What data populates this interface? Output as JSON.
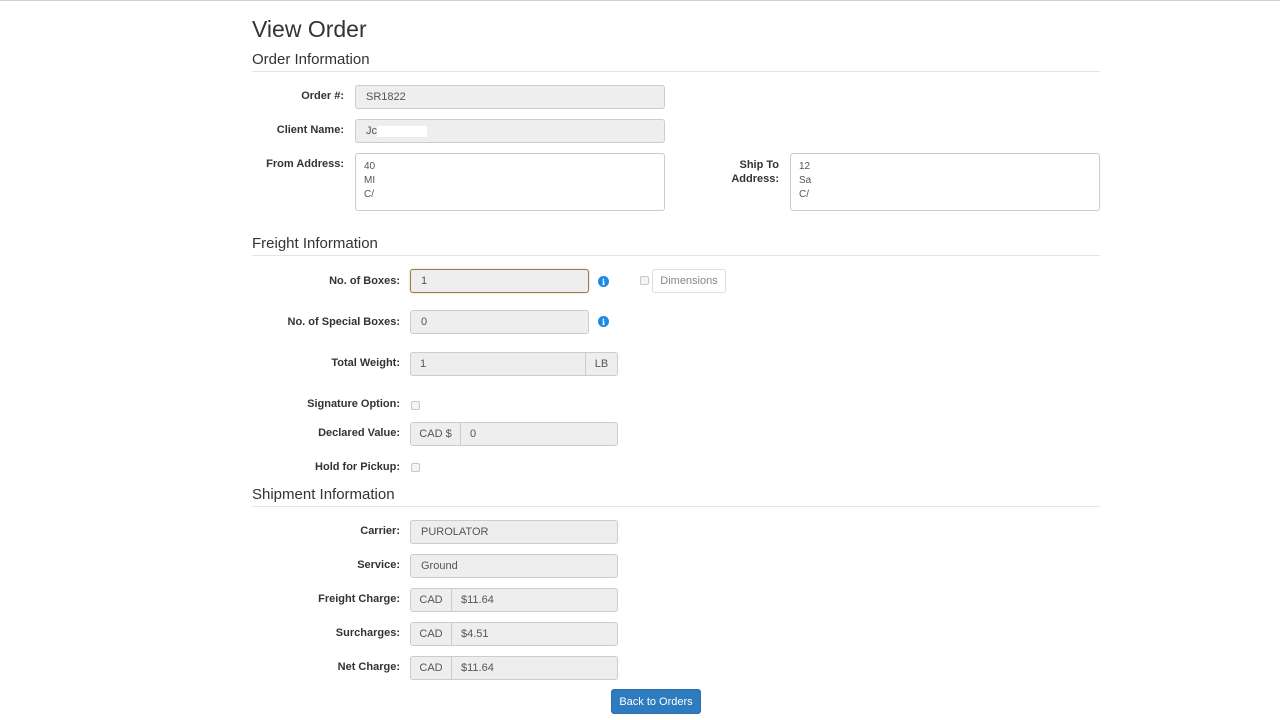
{
  "page": {
    "title": "View Order"
  },
  "order_info": {
    "heading": "Order Information",
    "order_number_label": "Order #:",
    "order_number": "SR1822",
    "client_name_label": "Client Name:",
    "client_name": "Jc",
    "from_address_label": "From Address:",
    "from_address_lines": [
      "40",
      "MI",
      "C/"
    ],
    "ship_to_label_line1": "Ship To",
    "ship_to_label_line2": "Address:",
    "ship_to_lines": [
      "12",
      "Sa",
      "C/"
    ]
  },
  "freight_info": {
    "heading": "Freight Information",
    "boxes_label": "No. of Boxes:",
    "boxes": "1",
    "special_boxes_label": "No. of Special Boxes:",
    "special_boxes": "0",
    "dimensions_label": "Dimensions",
    "dimensions_checked": false,
    "total_weight_label": "Total Weight:",
    "total_weight": "1",
    "weight_unit": "LB",
    "signature_label": "Signature Option:",
    "signature_checked": false,
    "declared_value_label": "Declared Value:",
    "declared_currency": "CAD $",
    "declared_value": "0",
    "hold_pickup_label": "Hold for Pickup:",
    "hold_pickup_checked": false,
    "info_icon_glyph": "i"
  },
  "shipment_info": {
    "heading": "Shipment Information",
    "carrier_label": "Carrier:",
    "carrier": "PUROLATOR",
    "service_label": "Service:",
    "service": "Ground",
    "freight_charge_label": "Freight Charge:",
    "freight_charge_currency": "CAD",
    "freight_charge": "$11.64",
    "surcharges_label": "Surcharges:",
    "surcharges_currency": "CAD",
    "surcharges": "$4.51",
    "net_charge_label": "Net Charge:",
    "net_charge_currency": "CAD",
    "net_charge": "$11.64"
  },
  "actions": {
    "back_label": "Back to Orders"
  },
  "colors": {
    "primary": "#2e7bbf",
    "info_icon": "#1e88e5",
    "focus_border": "#9e7a4b"
  }
}
